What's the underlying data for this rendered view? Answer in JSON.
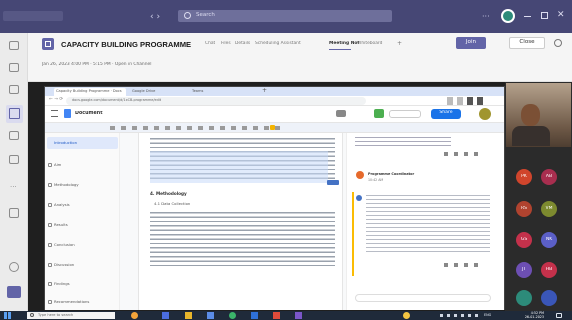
{
  "colors": {
    "teams_purple": "#464775",
    "rail": "#ebebeb",
    "accent": "#6264a7",
    "leave": "#c4314b",
    "taskbar": "#2c3e50",
    "doc_blue": "#4472c4"
  },
  "teams": {
    "search_placeholder": "Search",
    "meeting_title": "CAPACITY BUILDING PROGRAMME",
    "meeting_tabs": [
      "Chat",
      "Files",
      "Details",
      "Scheduling Assistant",
      "Meeting Notes",
      "Whiteboard",
      "+"
    ],
    "join_label": "Join",
    "close_label": "Close",
    "time_row": "Jan 26, 2023 4:00 PM · 5:15 PM  ·  Open in Channel",
    "rail_items": [
      "Activity",
      "Chat",
      "Teams",
      "Calendar",
      "Calls",
      "Files",
      "Apps",
      "Help"
    ]
  },
  "shared": {
    "browser_tabs": [
      "Capacity Building Programme · Docs",
      "Google Drive",
      "Teams"
    ],
    "address": "docs.google.com/document/d/1xCB-programme/edit",
    "doc_title": "Document",
    "share_label": "Share",
    "outline_items": [
      "Introduction",
      "Aim",
      "Methodology",
      "Analysis",
      "Results",
      "Conclusion",
      "Discussion",
      "Findings",
      "Recommendations"
    ],
    "doc_heading": "4. Methodology",
    "doc_subheading": "4.1 Data Collection",
    "comment_author": "Programme Coordinator",
    "comment_time": "10:42 AM"
  },
  "taskbar": {
    "search_placeholder": "Type here to search",
    "time": "4:52 PM",
    "date": "26-01-2023",
    "lang": "ENG"
  },
  "participants": [
    "PK",
    "AB",
    "RS",
    "VM",
    "GS",
    "NK",
    "JT",
    "HB"
  ]
}
